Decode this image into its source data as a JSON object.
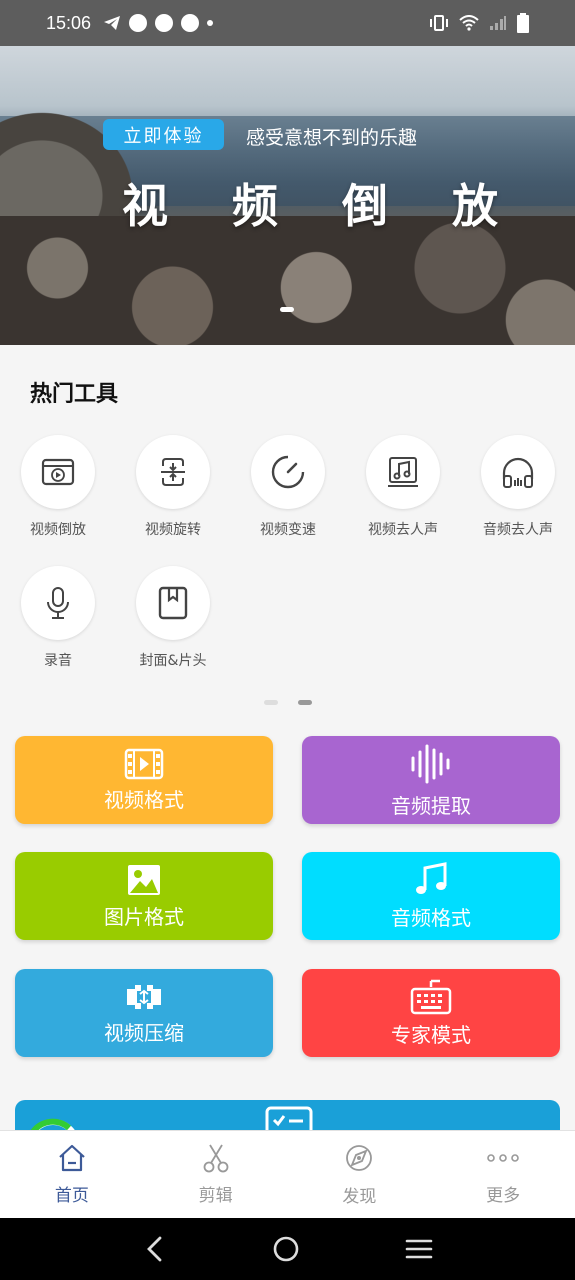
{
  "status_bar": {
    "time": "15:06"
  },
  "banner": {
    "badge": "立即体验",
    "subtitle": "感受意想不到的乐趣",
    "title": "视 频 倒 放"
  },
  "hot_tools": {
    "title": "热门工具",
    "items": [
      {
        "label": "视频倒放",
        "icon": "video-play-icon"
      },
      {
        "label": "视频旋转",
        "icon": "rotate-icon"
      },
      {
        "label": "视频变速",
        "icon": "speedometer-icon"
      },
      {
        "label": "视频去人声",
        "icon": "music-note-icon"
      },
      {
        "label": "音频去人声",
        "icon": "headphones-icon"
      },
      {
        "label": "录音",
        "icon": "microphone-icon"
      },
      {
        "label": "封面&片头",
        "icon": "bookmark-icon"
      }
    ]
  },
  "feature_buttons": [
    {
      "label": "视频格式",
      "color": "#ffb732",
      "icon": "film-icon"
    },
    {
      "label": "音频提取",
      "color": "#a865d0",
      "icon": "waveform-icon"
    },
    {
      "label": "图片格式",
      "color": "#99cc00",
      "icon": "image-icon"
    },
    {
      "label": "音频格式",
      "color": "#00ddff",
      "icon": "music-icon"
    },
    {
      "label": "视频压缩",
      "color": "#33aadd",
      "icon": "compress-icon"
    },
    {
      "label": "专家模式",
      "color": "#ff4444",
      "icon": "keyboard-icon"
    }
  ],
  "bottom_nav": {
    "items": [
      {
        "label": "首页",
        "icon": "home-icon",
        "active": true
      },
      {
        "label": "剪辑",
        "icon": "scissors-icon",
        "active": false
      },
      {
        "label": "发现",
        "icon": "compass-icon",
        "active": false
      },
      {
        "label": "更多",
        "icon": "more-icon",
        "active": false
      }
    ]
  },
  "colors": {
    "accent": "#3d5a98",
    "badge": "#29a8e8"
  }
}
